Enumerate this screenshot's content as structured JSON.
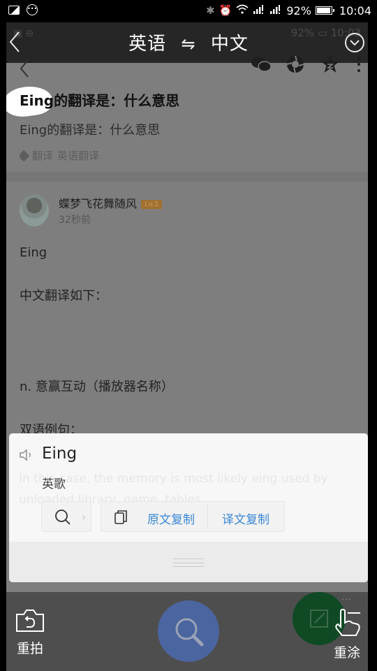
{
  "status_bar": {
    "left_icons": [
      "image-icon",
      "more-dots-icon"
    ],
    "right_icons": [
      "bluetooth-icon",
      "alarm-icon",
      "wifi-icon",
      "signal-icon",
      "signal-icon"
    ],
    "battery": "92%",
    "time": "10:04"
  },
  "background_status": {
    "battery": "92%",
    "time": "10:03"
  },
  "translator": {
    "source_lang": "英语",
    "swap_symbol": "⇋",
    "target_lang": "中文"
  },
  "question": {
    "title": "Eing的翻译是：什么意思",
    "subtitle": "Eing的翻译是：什么意思",
    "tags": [
      "翻译",
      "英语翻译"
    ]
  },
  "answer": {
    "author": "蝶梦飞花舞随风",
    "level": "Lv.1",
    "time": "32秒前",
    "lines": [
      "Eing",
      "中文翻译如下：",
      "n. 意赢互动（播放器名称）",
      "双语例句："
    ]
  },
  "popup": {
    "word": "Eing",
    "meaning": "英歌",
    "copy_source": "原文复制",
    "copy_target": "译文复制",
    "ghost_text": "In this case, the memory is most likely eing used by unloaded library, game, tables"
  },
  "bottom_bar": {
    "retake_label": "重拍",
    "redo_label": "重涂",
    "fab_dots": "..."
  }
}
